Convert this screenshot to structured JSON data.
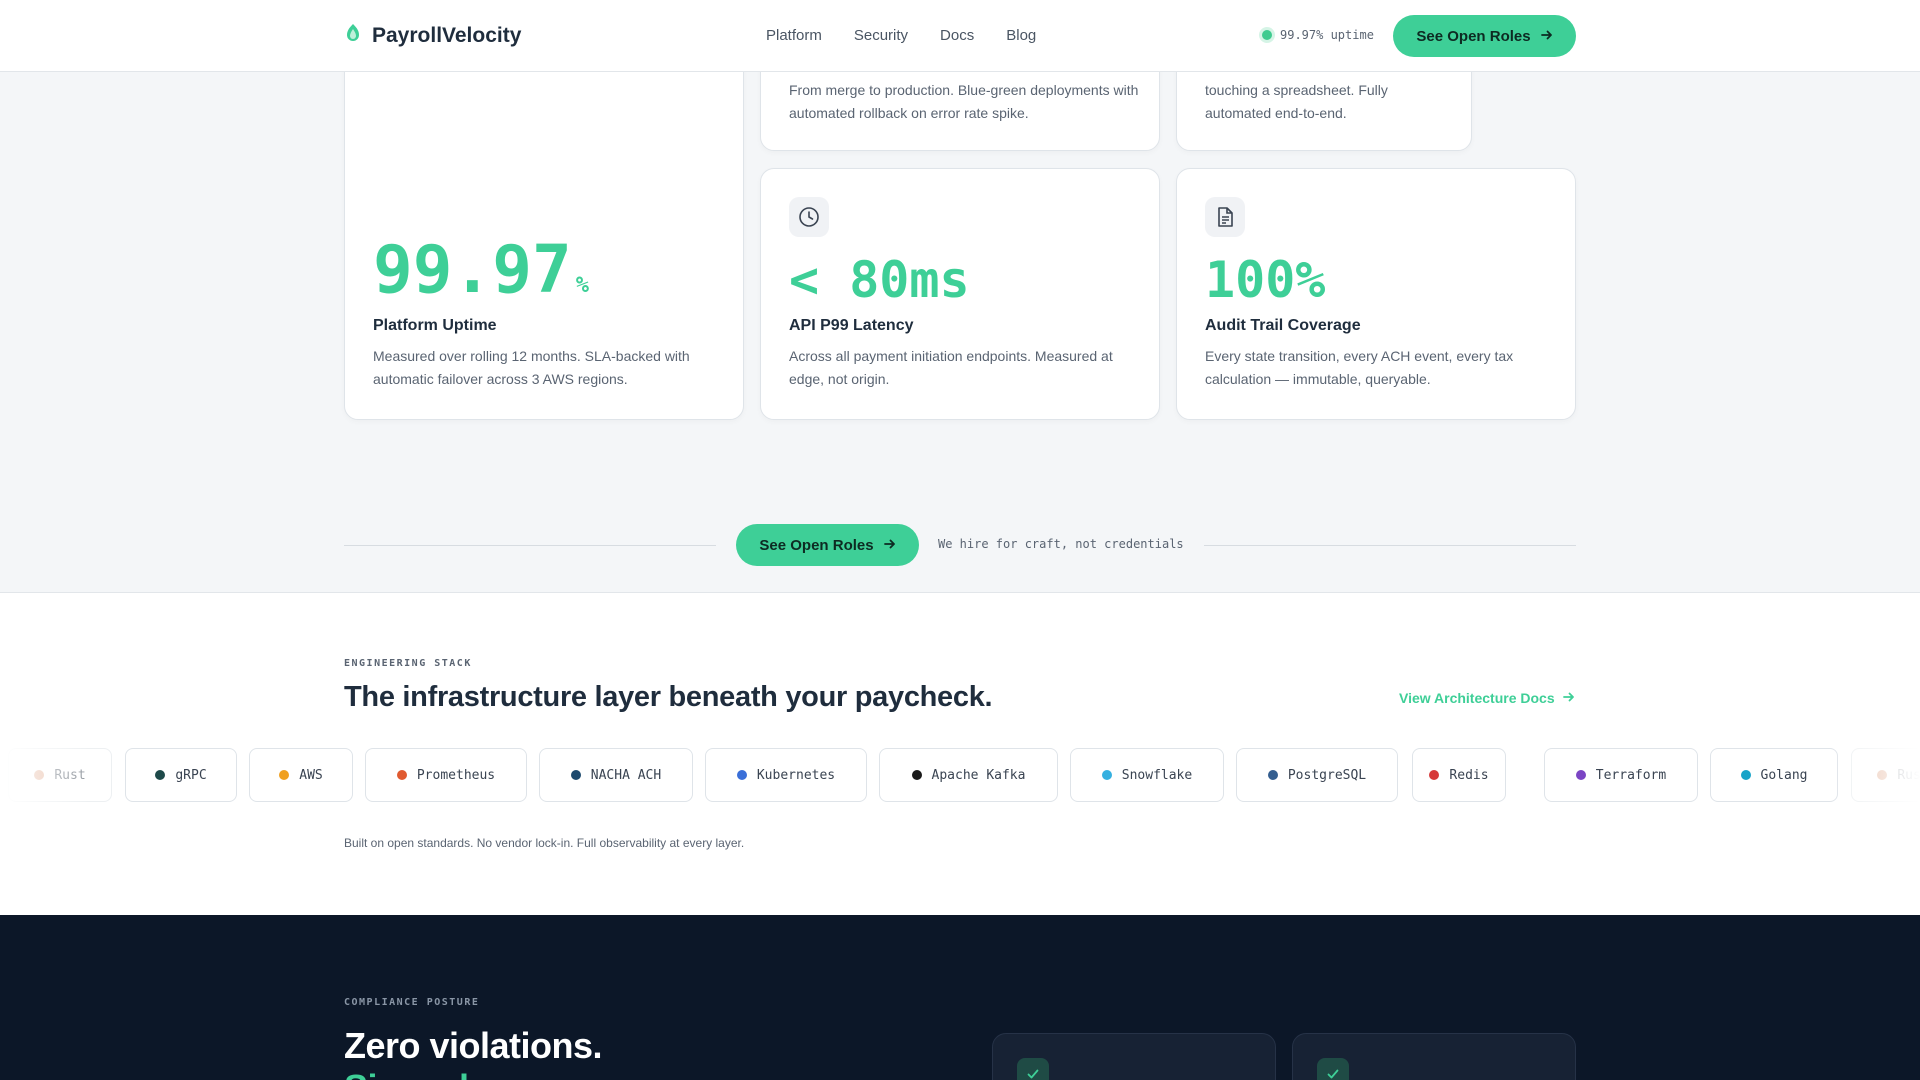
{
  "nav": {
    "brand": "PayrollVelocity",
    "links": [
      "Platform",
      "Security",
      "Docs",
      "Blog"
    ],
    "uptime_label": "99.97% uptime",
    "cta_label": "See Open Roles"
  },
  "top_cards": {
    "deploy_text": "From merge to production. Blue-green deployments with automated rollback on error rate spike.",
    "automation_text": "touching a spreadsheet. Fully automated end-to-end."
  },
  "metrics": [
    {
      "value": "99.97",
      "unit": "%",
      "title": "Platform Uptime",
      "desc": "Measured over rolling 12 months. SLA-backed with automatic failover across 3 AWS regions.",
      "icon": ""
    },
    {
      "value": "< 80ms",
      "unit": "",
      "title": "API P99 Latency",
      "desc": "Across all payment initiation endpoints. Measured at edge, not origin.",
      "icon": "clock-icon"
    },
    {
      "value": "100%",
      "unit": "",
      "title": "Audit Trail Coverage",
      "desc": "Every state transition, every ACH event, every tax calculation — immutable, queryable.",
      "icon": "document-icon"
    }
  ],
  "cta": {
    "label": "See Open Roles",
    "note": "We hire for craft, not credentials"
  },
  "stack": {
    "eyebrow": "ENGINEERING STACK",
    "title": "The infrastructure layer beneath your paycheck.",
    "link": "View Architecture Docs",
    "chips": [
      {
        "name": "Rust",
        "color": "#d4845a"
      },
      {
        "name": "gRPC",
        "color": "#1e4a4a"
      },
      {
        "name": "AWS",
        "color": "#f0a020"
      },
      {
        "name": "Prometheus",
        "color": "#e05a30"
      },
      {
        "name": "NACHA ACH",
        "color": "#1d4a6e"
      },
      {
        "name": "Kubernetes",
        "color": "#3a6fd8"
      },
      {
        "name": "Apache Kafka",
        "color": "#1a1a1a"
      },
      {
        "name": "Snowflake",
        "color": "#35b0e0"
      },
      {
        "name": "PostgreSQL",
        "color": "#345e8f"
      },
      {
        "name": "Redis",
        "color": "#d63a3a"
      },
      {
        "name": "Terraform",
        "color": "#7b45c4"
      },
      {
        "name": "Golang",
        "color": "#18a3c8"
      },
      {
        "name": "Rust",
        "color": "#d4845a"
      }
    ],
    "note": "Built on open standards. No vendor lock-in. Full observability at every layer."
  },
  "compliance": {
    "eyebrow": "COMPLIANCE POSTURE",
    "title": "Zero violations.",
    "subtitle": "Since day one."
  }
}
